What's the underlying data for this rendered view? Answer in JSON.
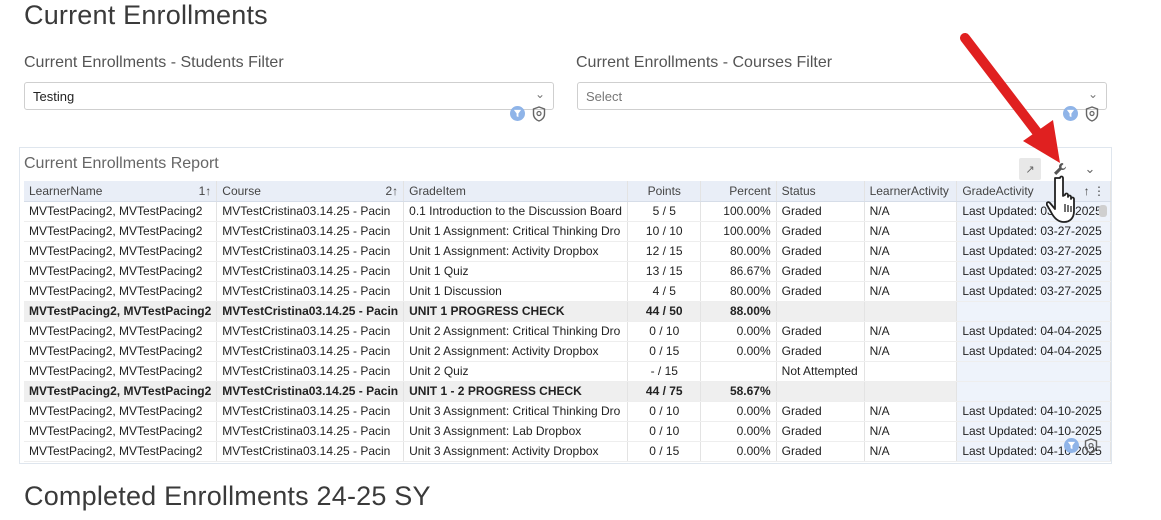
{
  "page_title": "Current Enrollments",
  "students_filter": {
    "label": "Current Enrollments - Students Filter",
    "value": "Testing"
  },
  "courses_filter": {
    "label": "Current Enrollments - Courses Filter",
    "placeholder": "Select"
  },
  "report": {
    "title": "Current Enrollments Report",
    "columns": [
      "LearnerName",
      "Course",
      "GradeItem",
      "Points",
      "Percent",
      "Status",
      "LearnerActivity",
      "GradeActivity"
    ],
    "sort_marks": {
      "learner": "1↑",
      "course": "2↑",
      "grade_activity": "↑"
    },
    "rows": [
      {
        "learner": "MVTestPacing2,  MVTestPacing2",
        "course": "MVTestCristina03.14.25 - Pacin",
        "item": "0.1 Introduction to the Discussion Board",
        "points": "5 / 5",
        "percent": "100.00%",
        "status": "Graded",
        "la": "N/A",
        "ga": "Last Updated: 03-27-2025"
      },
      {
        "learner": "MVTestPacing2,  MVTestPacing2",
        "course": "MVTestCristina03.14.25 - Pacin",
        "item": "Unit 1 Assignment: Critical Thinking Dro",
        "points": "10 / 10",
        "percent": "100.00%",
        "status": "Graded",
        "la": "N/A",
        "ga": "Last Updated: 03-27-2025"
      },
      {
        "learner": "MVTestPacing2,  MVTestPacing2",
        "course": "MVTestCristina03.14.25 - Pacin",
        "item": "Unit 1 Assignment: Activity Dropbox",
        "points": "12 / 15",
        "percent": "80.00%",
        "status": "Graded",
        "la": "N/A",
        "ga": "Last Updated: 03-27-2025"
      },
      {
        "learner": "MVTestPacing2,  MVTestPacing2",
        "course": "MVTestCristina03.14.25 - Pacin",
        "item": "Unit 1 Quiz",
        "points": "13 / 15",
        "percent": "86.67%",
        "status": "Graded",
        "la": "N/A",
        "ga": "Last Updated: 03-27-2025"
      },
      {
        "learner": "MVTestPacing2,  MVTestPacing2",
        "course": "MVTestCristina03.14.25 - Pacin",
        "item": "Unit 1 Discussion",
        "points": "4 / 5",
        "percent": "80.00%",
        "status": "Graded",
        "la": "N/A",
        "ga": "Last Updated: 03-27-2025"
      },
      {
        "bold": true,
        "learner": "MVTestPacing2,  MVTestPacing2",
        "course": "MVTestCristina03.14.25 - Pacin",
        "item": "UNIT 1 PROGRESS CHECK",
        "points": "44 / 50",
        "percent": "88.00%",
        "status": "",
        "la": "",
        "ga": ""
      },
      {
        "learner": "MVTestPacing2,  MVTestPacing2",
        "course": "MVTestCristina03.14.25 - Pacin",
        "item": "Unit 2 Assignment: Critical Thinking Dro",
        "points": "0 / 10",
        "percent": "0.00%",
        "status": "Graded",
        "la": "N/A",
        "ga": "Last Updated: 04-04-2025"
      },
      {
        "learner": "MVTestPacing2,  MVTestPacing2",
        "course": "MVTestCristina03.14.25 - Pacin",
        "item": "Unit 2 Assignment: Activity Dropbox",
        "points": "0 / 15",
        "percent": "0.00%",
        "status": "Graded",
        "la": "N/A",
        "ga": "Last Updated: 04-04-2025"
      },
      {
        "learner": "MVTestPacing2,  MVTestPacing2",
        "course": "MVTestCristina03.14.25 - Pacin",
        "item": "Unit 2 Quiz",
        "points": "- / 15",
        "percent": "",
        "status": "Not Attempted",
        "la": "",
        "ga": ""
      },
      {
        "bold": true,
        "learner": "MVTestPacing2,  MVTestPacing2",
        "course": "MVTestCristina03.14.25 - Pacin",
        "item": "UNIT 1 - 2 PROGRESS CHECK",
        "points": "44 / 75",
        "percent": "58.67%",
        "status": "",
        "la": "",
        "ga": ""
      },
      {
        "learner": "MVTestPacing2,  MVTestPacing2",
        "course": "MVTestCristina03.14.25 - Pacin",
        "item": "Unit 3 Assignment: Critical Thinking Dro",
        "points": "0 / 10",
        "percent": "0.00%",
        "status": "Graded",
        "la": "N/A",
        "ga": "Last Updated: 04-10-2025"
      },
      {
        "learner": "MVTestPacing2,  MVTestPacing2",
        "course": "MVTestCristina03.14.25 - Pacin",
        "item": "Unit 3 Assignment: Lab Dropbox",
        "points": "0 / 10",
        "percent": "0.00%",
        "status": "Graded",
        "la": "N/A",
        "ga": "Last Updated: 04-10-2025"
      },
      {
        "learner": "MVTestPacing2,  MVTestPacing2",
        "course": "MVTestCristina03.14.25 - Pacin",
        "item": "Unit 3 Assignment: Activity Dropbox",
        "points": "0 / 15",
        "percent": "0.00%",
        "status": "Graded",
        "la": "N/A",
        "ga": "Last Updated: 04-10-2025"
      }
    ]
  },
  "next_section_title": "Completed Enrollments 24-25 SY",
  "annotation": {
    "arrow_color": "#e02020"
  }
}
